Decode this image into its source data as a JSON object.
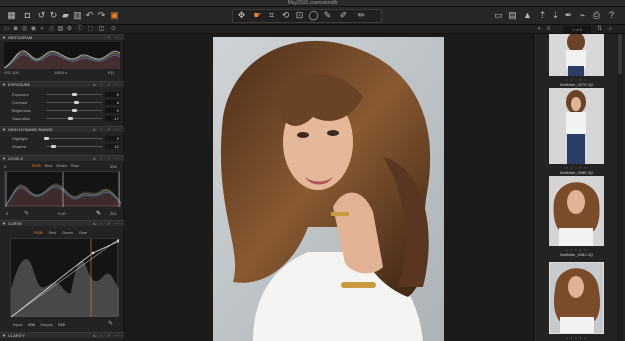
{
  "window": {
    "title": "May2015.cosessiondb"
  },
  "toolbar": {
    "left_icons": [
      "grid-icon",
      "camera-icon",
      "rotate-left-icon",
      "rotate-right-icon",
      "folder-icon",
      "trash-icon",
      "undo-icon",
      "redo-icon",
      "stack-icon"
    ],
    "center_icons": [
      "pan-icon",
      "select-icon",
      "crop-icon",
      "rotate-icon",
      "keystone-icon",
      "spot-icon",
      "mask-brush-icon",
      "picker-icon",
      "color-picker-icon"
    ],
    "right_icons": [
      "compare-icon",
      "grid-view-icon",
      "warning-icon",
      "copy-adjust-icon",
      "paste-adjust-icon",
      "brush-icon",
      "wand-icon",
      "print-icon",
      "settings-icon",
      "help-icon"
    ]
  },
  "histogram": {
    "header": "HISTOGRAM",
    "iso": "ISO 100",
    "shutter": "1/500 s",
    "aperture": "f/11"
  },
  "exposure": {
    "header": "EXPOSURE",
    "rows": [
      {
        "label": "Exposure",
        "value": "0",
        "level": 0.5
      },
      {
        "label": "Contrast",
        "value": "6",
        "level": 0.53
      },
      {
        "label": "Brightness",
        "value": "0",
        "level": 0.5
      },
      {
        "label": "Saturation",
        "value": "-17",
        "level": 0.42
      }
    ]
  },
  "hdr": {
    "header": "HIGH DYNAMIC RANGE",
    "rows": [
      {
        "label": "Highlight",
        "value": "0",
        "level": 0.0
      },
      {
        "label": "Shadow",
        "value": "12",
        "level": 0.12
      }
    ]
  },
  "levels": {
    "header": "LEVELS",
    "left_value": "0",
    "right_value": "255",
    "tabs": [
      "RGB",
      "Red",
      "Green",
      "Blue"
    ],
    "bottom_left": "0",
    "midpoint": "0.00",
    "bottom_right": "251"
  },
  "curve": {
    "header": "CURVE",
    "tabs": [
      "RGB",
      "Red",
      "Green",
      "Blue"
    ],
    "input_label": "Input:",
    "input_value": "206",
    "output_label": "Output:",
    "output_value": "218"
  },
  "clarity": {
    "header": "CLARITY"
  },
  "browser": {
    "counter": "1 of 8",
    "items": [
      {
        "name": "Mathilde_0079.IIQ",
        "stars": "• • • • •"
      },
      {
        "name": "Mathilde_0080.IIQ",
        "stars": "• • • • •"
      },
      {
        "name": "Mathilde_0081.IIQ",
        "stars": "• • • • •"
      },
      {
        "name": "",
        "stars": "• • • • •"
      }
    ]
  },
  "colors": {
    "accent": "#e8832e",
    "panel": "#232323",
    "viewer": "#1b1b1b"
  }
}
